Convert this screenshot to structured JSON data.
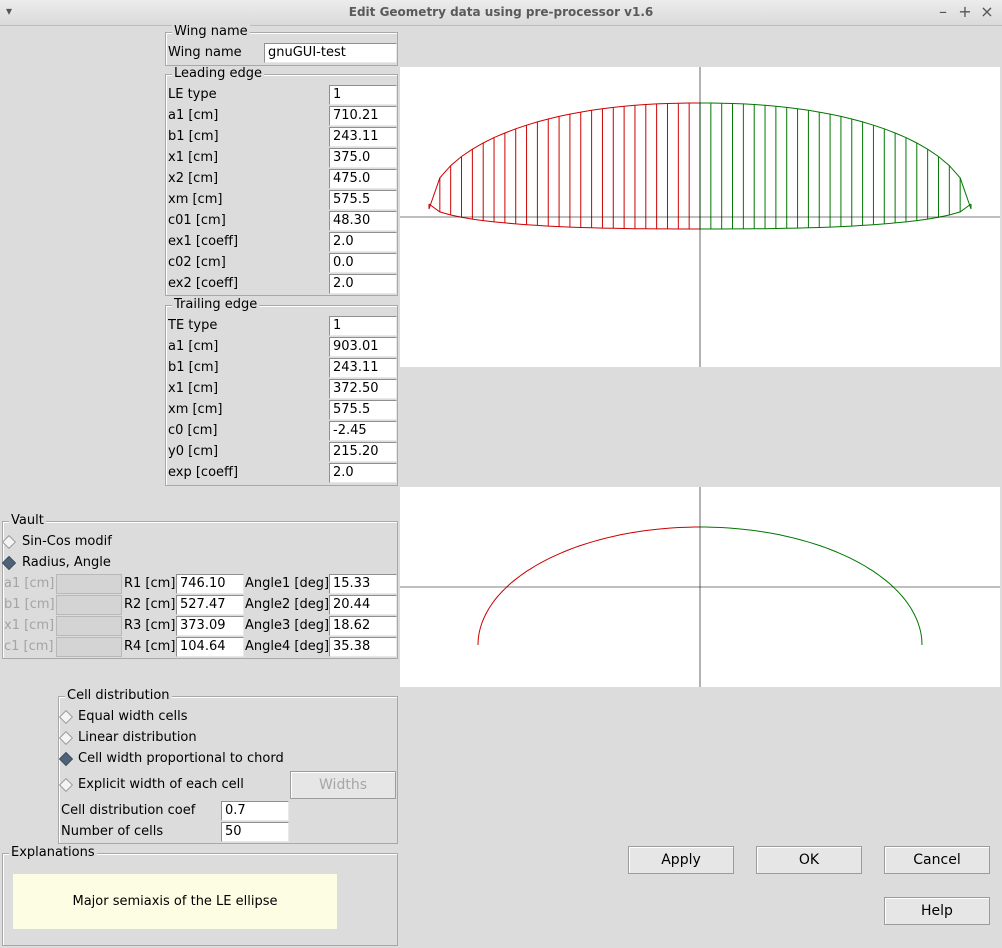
{
  "window": {
    "title": "Edit Geometry data using pre-processor v1.6",
    "menu_glyph": "▾",
    "min_glyph": "–",
    "max_glyph": "+",
    "close_glyph": "×"
  },
  "wing_name": {
    "section": "Wing name",
    "label": "Wing name",
    "value": "gnuGUI-test"
  },
  "leading_edge": {
    "section": "Leading edge",
    "rows": [
      {
        "label": "LE type",
        "value": "1"
      },
      {
        "label": "a1 [cm]",
        "value": "710.21"
      },
      {
        "label": "b1 [cm]",
        "value": "243.11"
      },
      {
        "label": "x1 [cm]",
        "value": "375.0"
      },
      {
        "label": "x2 [cm]",
        "value": "475.0"
      },
      {
        "label": "xm [cm]",
        "value": "575.5"
      },
      {
        "label": "c01 [cm]",
        "value": "48.30"
      },
      {
        "label": "ex1 [coeff]",
        "value": "2.0"
      },
      {
        "label": "c02 [cm]",
        "value": "0.0"
      },
      {
        "label": "ex2 [coeff]",
        "value": "2.0"
      }
    ]
  },
  "trailing_edge": {
    "section": "Trailing edge",
    "rows": [
      {
        "label": "TE type",
        "value": "1"
      },
      {
        "label": "a1 [cm]",
        "value": "903.01"
      },
      {
        "label": "b1 [cm]",
        "value": "243.11"
      },
      {
        "label": "x1 [cm]",
        "value": "372.50"
      },
      {
        "label": "xm [cm]",
        "value": "575.5"
      },
      {
        "label": "c0 [cm]",
        "value": "-2.45"
      },
      {
        "label": "y0 [cm]",
        "value": "215.20"
      },
      {
        "label": "exp [coeff]",
        "value": "2.0"
      }
    ]
  },
  "vault": {
    "section": "Vault",
    "options": [
      {
        "label": "Sin-Cos modif",
        "selected": false
      },
      {
        "label": "Radius, Angle",
        "selected": true
      }
    ],
    "rows": [
      {
        "ab_label": "a1 [cm]",
        "ab_value": "",
        "r_label": "R1 [cm]",
        "r_value": "746.10",
        "angle_label": "Angle1 [deg]",
        "angle_value": "15.33"
      },
      {
        "ab_label": "b1 [cm]",
        "ab_value": "",
        "r_label": "R2 [cm]",
        "r_value": "527.47",
        "angle_label": "Angle2 [deg]",
        "angle_value": "20.44"
      },
      {
        "ab_label": "x1 [cm]",
        "ab_value": "",
        "r_label": "R3 [cm]",
        "r_value": "373.09",
        "angle_label": "Angle3 [deg]",
        "angle_value": "18.62"
      },
      {
        "ab_label": "c1 [cm]",
        "ab_value": "",
        "r_label": "R4 [cm]",
        "r_value": "104.64",
        "angle_label": "Angle4 [deg]",
        "angle_value": "35.38"
      }
    ]
  },
  "cell_distribution": {
    "section": "Cell distribution",
    "options": [
      {
        "label": "Equal width cells",
        "selected": false
      },
      {
        "label": "Linear distribution",
        "selected": false
      },
      {
        "label": "Cell width proportional to chord",
        "selected": true
      },
      {
        "label": "Explicit width of each cell",
        "selected": false
      }
    ],
    "widths_button": "Widths",
    "coef_label": "Cell distribution coef",
    "coef_value": "0.7",
    "cells_label": "Number of cells",
    "cells_value": "50"
  },
  "explanations": {
    "section": "Explanations",
    "text": "Major semiaxis of the LE ellipse"
  },
  "buttons": {
    "apply": "Apply",
    "ok": "OK",
    "cancel": "Cancel",
    "help": "Help"
  },
  "colors": {
    "left_half": "#cc0000",
    "right_half": "#007700",
    "axis": "#000000"
  },
  "plot_planform": {
    "cells": 50
  },
  "plot_vault": {
    "angles_deg": [
      15.33,
      20.44,
      18.62,
      35.38
    ]
  }
}
